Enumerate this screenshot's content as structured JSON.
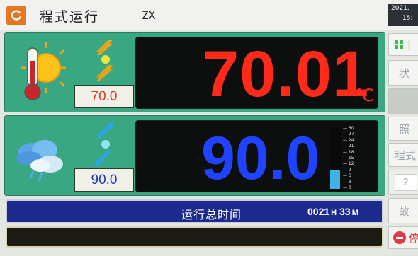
{
  "header": {
    "title": "程式运行",
    "user": "ZX",
    "clock_line1": "2021.",
    "clock_line2": "15:"
  },
  "temperature": {
    "value": "70.01",
    "unit": "℃",
    "setpoint": "70.0",
    "color": "#ff2a1a",
    "icon": "thermometer-sun-icon"
  },
  "humidity": {
    "value": "90.0",
    "setpoint": "90.0",
    "color": "#1f43ff",
    "icon": "cloud-rain-icon",
    "gauge_level_percent": 30,
    "gauge_ticks": [
      "30",
      "27",
      "24",
      "21",
      "18",
      "15",
      "12",
      "9",
      "6",
      "3",
      "0"
    ]
  },
  "runtime": {
    "label": "运行总时间",
    "hours": "0021",
    "hours_unit": "H",
    "minutes": "33",
    "minutes_unit": "M"
  },
  "sidebar": {
    "btn1_text": "|",
    "btn2_text": "状",
    "btn3_text": "",
    "btn4_text": "照",
    "btn5_text": "程式",
    "stepper_value": "2",
    "btn7_text": "故",
    "stop_text": "停"
  }
}
